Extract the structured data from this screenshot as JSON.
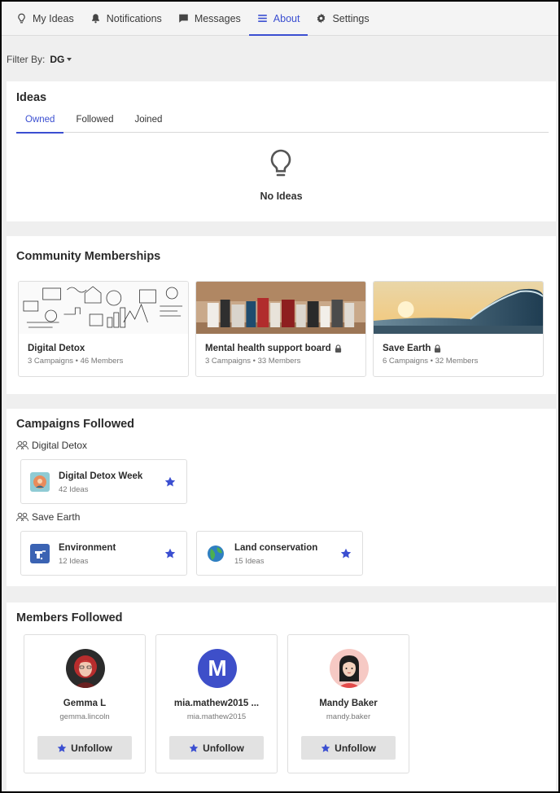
{
  "nav": {
    "items": [
      {
        "label": "My Ideas",
        "icon": "lightbulb-icon"
      },
      {
        "label": "Notifications",
        "icon": "bell-icon"
      },
      {
        "label": "Messages",
        "icon": "chat-icon"
      },
      {
        "label": "About",
        "icon": "menu-icon",
        "active": true
      },
      {
        "label": "Settings",
        "icon": "gear-icon"
      }
    ]
  },
  "filter": {
    "label": "Filter By:",
    "value": "DG"
  },
  "ideas": {
    "title": "Ideas",
    "tabs": [
      "Owned",
      "Followed",
      "Joined"
    ],
    "active_tab": "Owned",
    "empty_text": "No Ideas"
  },
  "communities": {
    "title": "Community Memberships",
    "items": [
      {
        "name": "Digital Detox",
        "meta": "3 Campaigns • 46 Members",
        "locked": false
      },
      {
        "name": "Mental health support board",
        "meta": "3 Campaigns • 33 Members",
        "locked": true
      },
      {
        "name": "Save Earth",
        "meta": "6 Campaigns • 32 Members",
        "locked": true
      }
    ]
  },
  "campaigns": {
    "title": "Campaigns Followed",
    "groups": [
      {
        "label": "Digital Detox",
        "items": [
          {
            "name": "Digital Detox Week",
            "meta": "42 Ideas"
          }
        ]
      },
      {
        "label": "Save Earth",
        "items": [
          {
            "name": "Environment",
            "meta": "12 Ideas"
          },
          {
            "name": "Land conservation",
            "meta": "15 Ideas"
          }
        ]
      }
    ]
  },
  "members": {
    "title": "Members Followed",
    "button_label": "Unfollow",
    "items": [
      {
        "name": "Gemma L",
        "handle": "gemma.lincoln"
      },
      {
        "name": "mia.mathew2015 ...",
        "handle": "mia.mathew2015",
        "initial": "M"
      },
      {
        "name": "Mandy Baker",
        "handle": "mandy.baker"
      }
    ]
  },
  "colors": {
    "accent": "#3b4fd1",
    "star": "#3b4fd1",
    "avatar_m": "#3e4fc9"
  }
}
